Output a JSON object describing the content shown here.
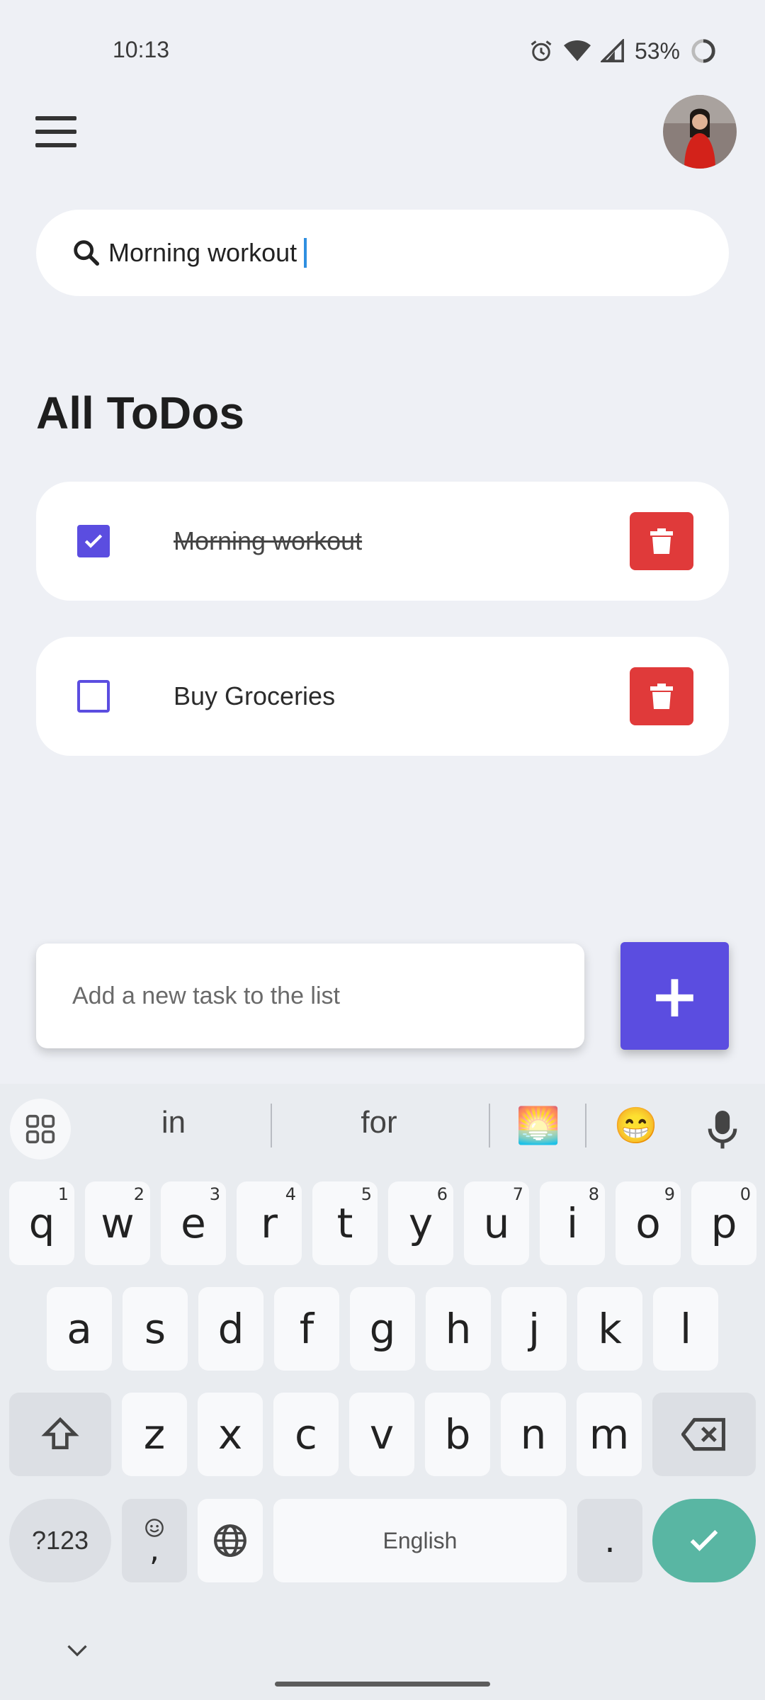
{
  "status_bar": {
    "time": "10:13",
    "battery": "53%"
  },
  "search": {
    "value": "Morning workout"
  },
  "page_title": "All ToDos",
  "todos": [
    {
      "text": "Morning workout",
      "done": true
    },
    {
      "text": "Buy Groceries",
      "done": false
    }
  ],
  "add_task": {
    "placeholder": "Add a new task to the list",
    "button_symbol": "+"
  },
  "keyboard": {
    "suggestions": [
      "in",
      "for"
    ],
    "emoji_suggestions": [
      "🌅",
      "😁"
    ],
    "row1": [
      "q",
      "w",
      "e",
      "r",
      "t",
      "y",
      "u",
      "i",
      "o",
      "p"
    ],
    "row1_hints": [
      "1",
      "2",
      "3",
      "4",
      "5",
      "6",
      "7",
      "8",
      "9",
      "0"
    ],
    "row2": [
      "a",
      "s",
      "d",
      "f",
      "g",
      "h",
      "j",
      "k",
      "l"
    ],
    "row3": [
      "z",
      "x",
      "c",
      "v",
      "b",
      "n",
      "m"
    ],
    "symbols_label": "?123",
    "comma": ",",
    "space_label": "English",
    "period": "."
  },
  "colors": {
    "accent": "#5b4de0",
    "delete": "#e03a3a",
    "enter": "#59b6a3",
    "background": "#eef0f5"
  }
}
